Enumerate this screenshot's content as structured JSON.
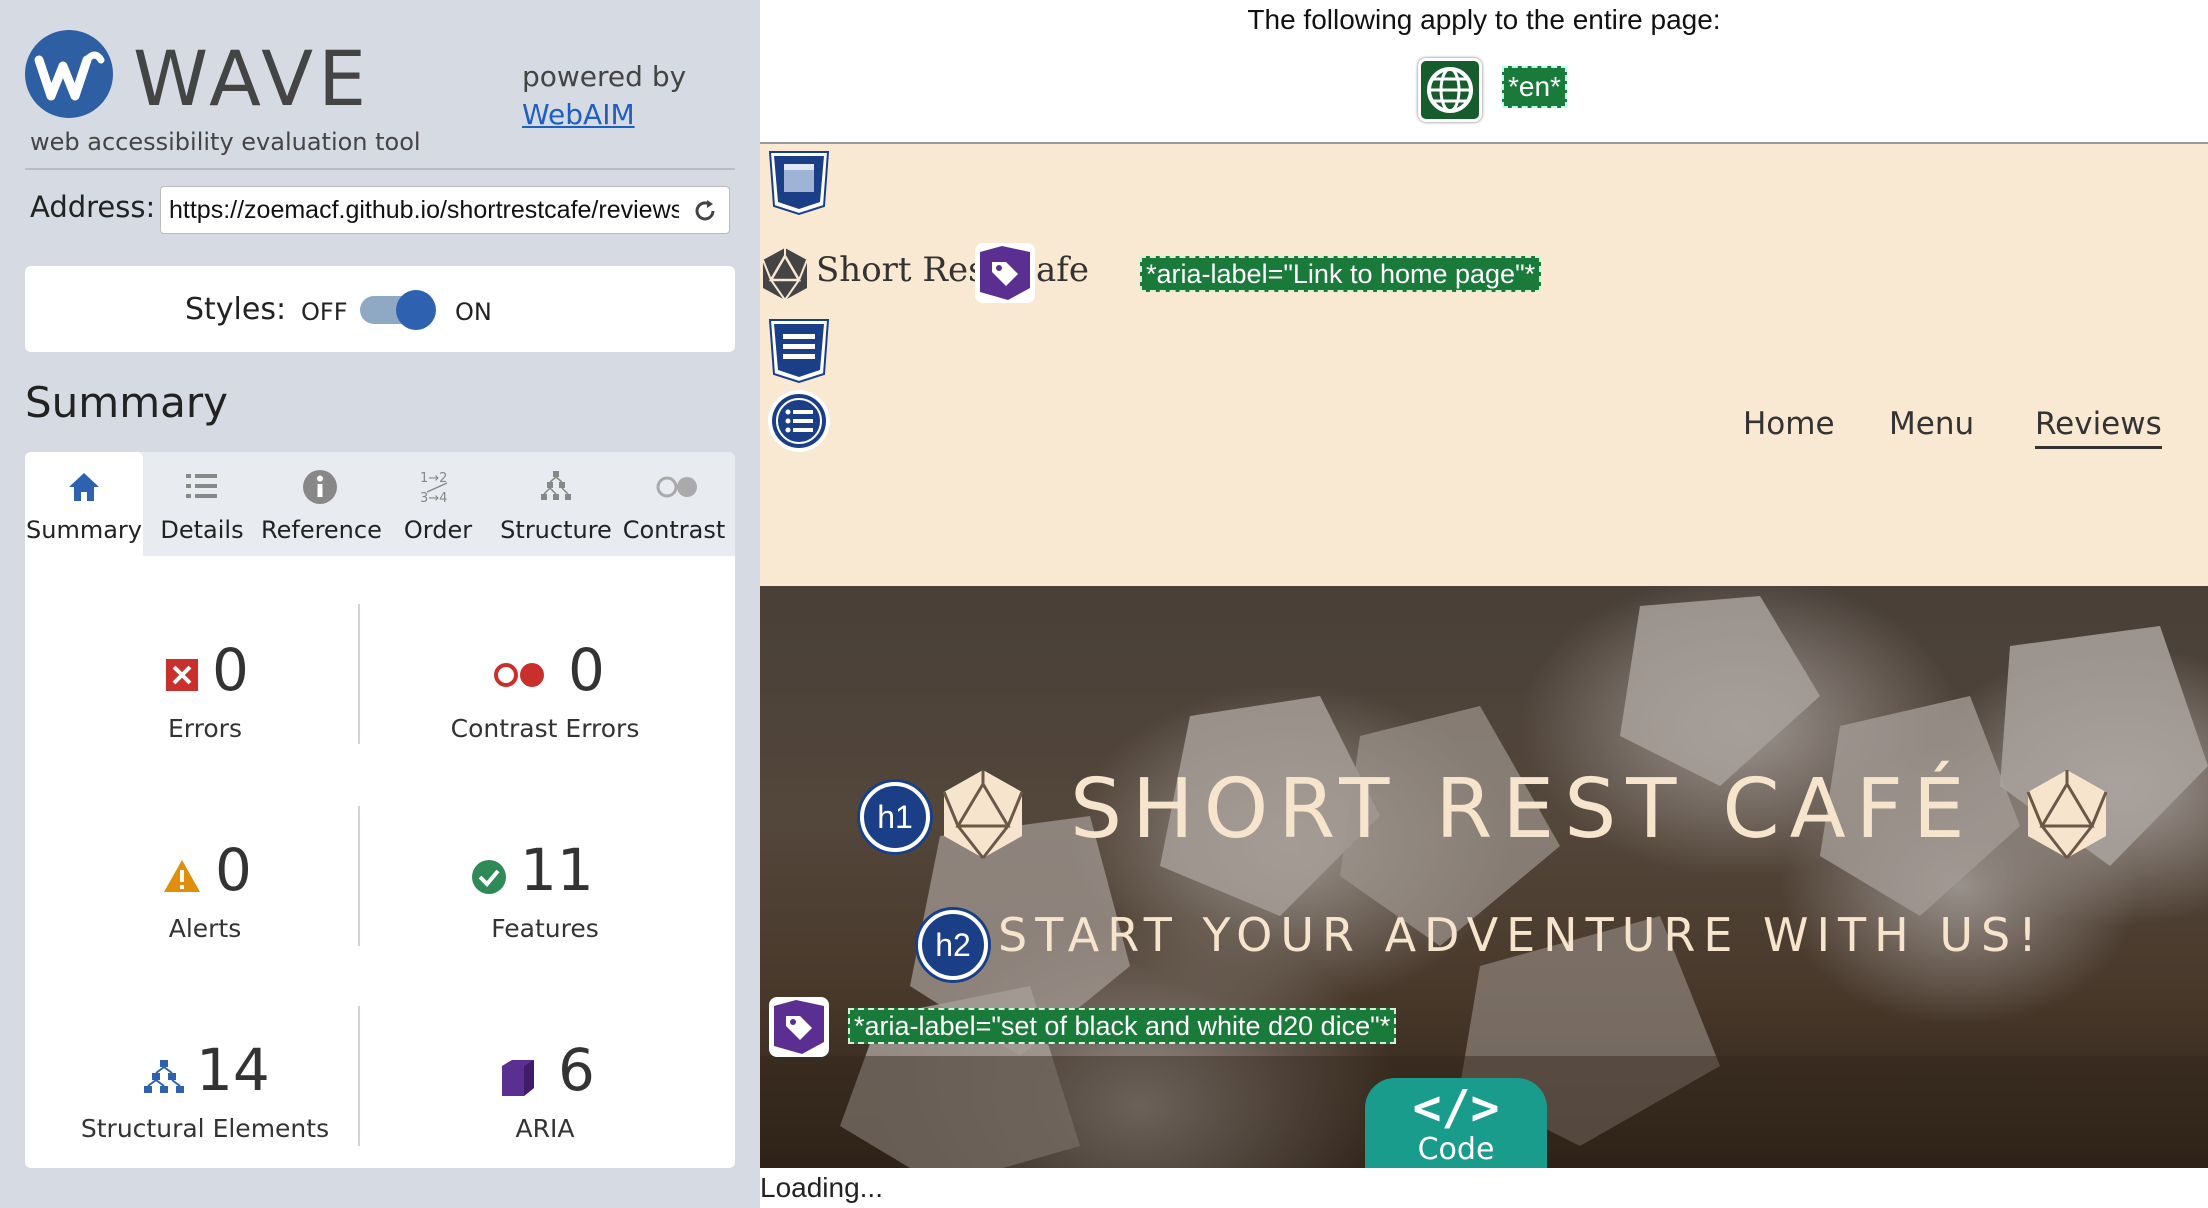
{
  "app": {
    "brand_name": "WAVE",
    "tagline": "web accessibility evaluation tool",
    "powered_by": "powered by",
    "webaim_link": "WebAIM"
  },
  "address": {
    "label": "Address:",
    "value": "https://zoemacf.github.io/shortrestcafe/reviews.html"
  },
  "styles": {
    "label": "Styles:",
    "off": "OFF",
    "on": "ON",
    "state": "on"
  },
  "summary": {
    "heading": "Summary",
    "tabs": [
      {
        "label": "Summary",
        "icon": "home-icon",
        "active": true
      },
      {
        "label": "Details",
        "icon": "list-icon",
        "active": false
      },
      {
        "label": "Reference",
        "icon": "info-icon",
        "active": false
      },
      {
        "label": "Order",
        "icon": "order-icon",
        "active": false
      },
      {
        "label": "Structure",
        "icon": "structure-icon",
        "active": false
      },
      {
        "label": "Contrast",
        "icon": "contrast-icon",
        "active": false
      }
    ],
    "stats": {
      "errors": {
        "count": "0",
        "label": "Errors"
      },
      "contrast_errors": {
        "count": "0",
        "label": "Contrast Errors"
      },
      "alerts": {
        "count": "0",
        "label": "Alerts"
      },
      "features": {
        "count": "11",
        "label": "Features"
      },
      "structural": {
        "count": "14",
        "label": "Structural Elements"
      },
      "aria": {
        "count": "6",
        "label": "ARIA"
      }
    },
    "colors": {
      "error": "#c9302c",
      "alert": "#e08e0b",
      "feature": "#2e8b57",
      "structure": "#2e62b0",
      "aria": "#5b2e91"
    }
  },
  "page_info": {
    "heading": "The following apply to the entire page:",
    "lang_tag": "*en*"
  },
  "site": {
    "logo_text": "Short Rest Cafe",
    "aria_label_logo": "*aria-label=\"Link to home page\"*",
    "nav": {
      "home": "Home",
      "menu": "Menu",
      "reviews": "Reviews"
    },
    "hero_title": "SHORT REST CAFÉ",
    "hero_subtitle": "START YOUR ADVENTURE WITH US!",
    "h1_badge": "h1",
    "h2_badge": "h2",
    "aria_label_image": "*aria-label=\"set of black and white d20 dice\"*"
  },
  "code_tab": {
    "glyph": "</>",
    "label": "Code"
  },
  "status": {
    "loading": "Loading..."
  }
}
